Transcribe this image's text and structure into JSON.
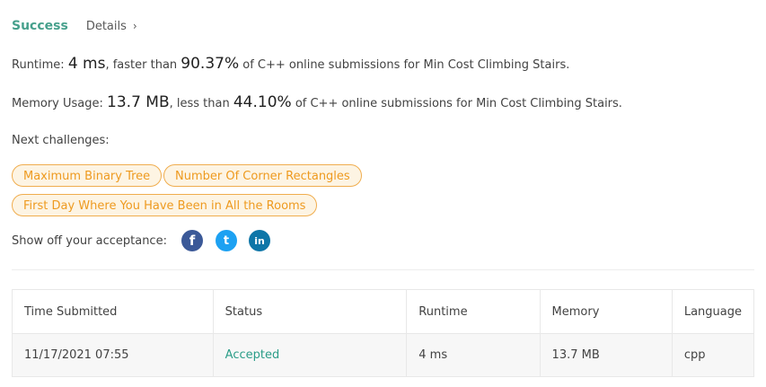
{
  "header": {
    "status": "Success",
    "details_label": "Details",
    "details_chevron": "›"
  },
  "runtime": {
    "label": "Runtime: ",
    "value": "4 ms",
    "comparison": ", faster than ",
    "percent": "90.37%",
    "suffix": " of C++ online submissions for Min Cost Climbing Stairs."
  },
  "memory": {
    "label": "Memory Usage: ",
    "value": "13.7 MB",
    "comparison": ", less than ",
    "percent": "44.10%",
    "suffix": " of C++ online submissions for Min Cost Climbing Stairs."
  },
  "next_challenges": {
    "label": "Next challenges:",
    "items": [
      "Maximum Binary Tree",
      "Number Of Corner Rectangles",
      "First Day Where You Have Been in All the Rooms"
    ]
  },
  "share": {
    "label": "Show off your acceptance:",
    "icons": [
      {
        "name": "facebook-icon",
        "glyph": "f",
        "color": "#3b5998"
      },
      {
        "name": "twitter-icon",
        "glyph": "t",
        "color": "#1da1f2"
      },
      {
        "name": "linkedin-icon",
        "glyph": "in",
        "color": "#0e76a8"
      }
    ]
  },
  "table": {
    "headers": [
      "Time Submitted",
      "Status",
      "Runtime",
      "Memory",
      "Language"
    ],
    "rows": [
      [
        "11/17/2021 07:55",
        "Accepted",
        "4 ms",
        "13.7 MB",
        "cpp"
      ]
    ]
  },
  "colors": {
    "success": "#46a08c",
    "accepted": "#2b9d88",
    "pill_border": "#f0ad4e",
    "pill_text": "#ee9a1f"
  }
}
